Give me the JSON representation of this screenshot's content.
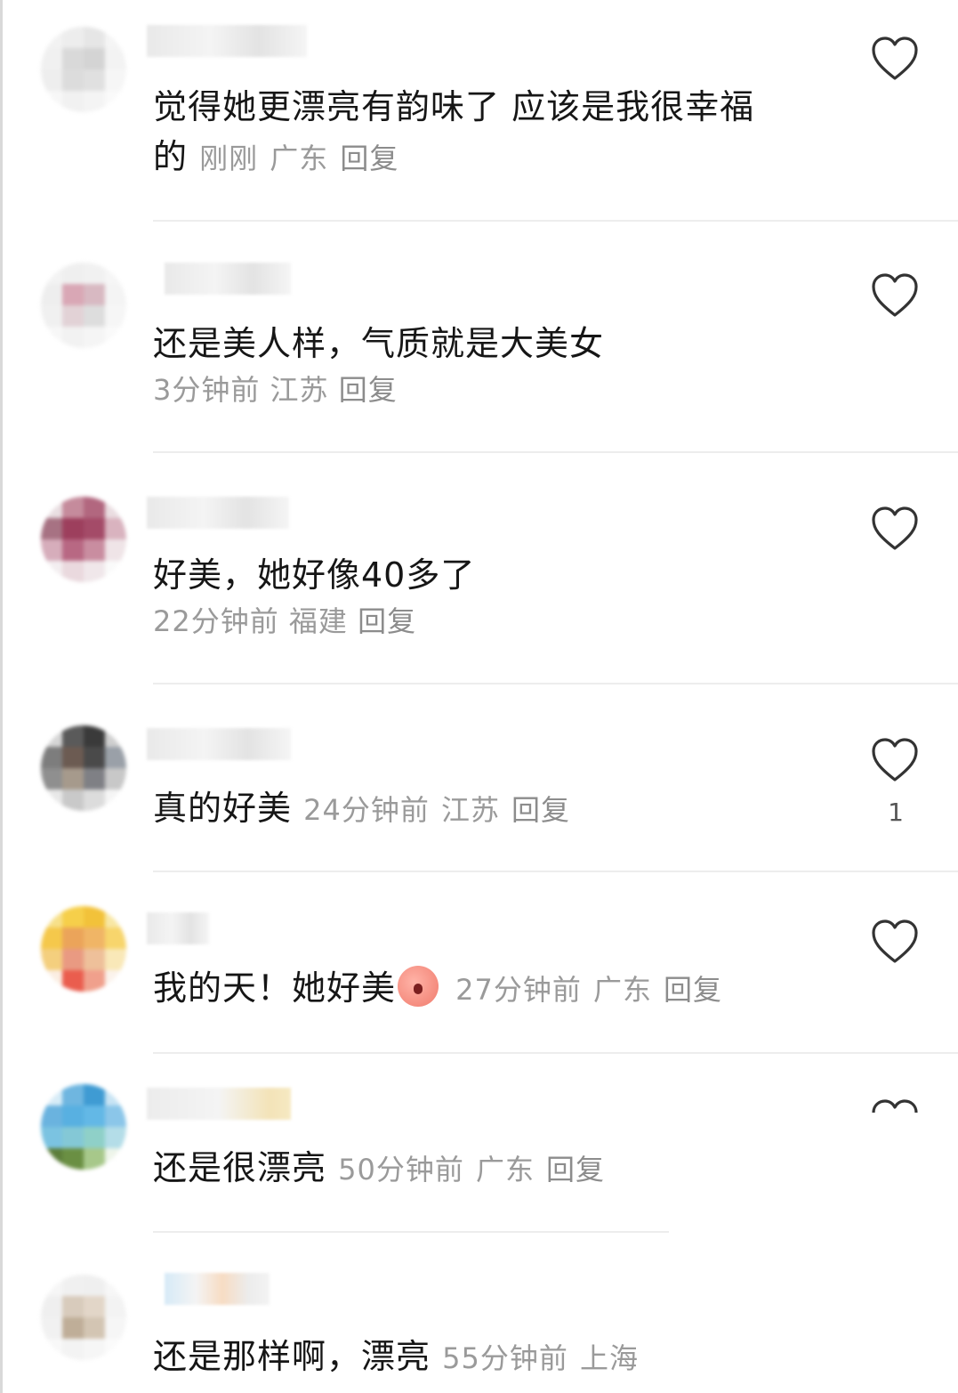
{
  "colors": {
    "text": "#161616",
    "meta": "#9a9a9a",
    "divider": "#ededed",
    "heart": "#333333"
  },
  "comments": [
    {
      "text": "觉得她更漂亮有韵味了 应该是我很幸福",
      "text2": "的",
      "time": "刚刚",
      "region": "广东",
      "reply": "回复",
      "likes": ""
    },
    {
      "text": "还是美人样，气质就是大美女",
      "time": "3分钟前",
      "region": "江苏",
      "reply": "回复",
      "likes": ""
    },
    {
      "text": "好美，她好像40多了",
      "time": "22分钟前",
      "region": "福建",
      "reply": "回复",
      "likes": ""
    },
    {
      "text": "真的好美",
      "time": "24分钟前",
      "region": "江苏",
      "reply": "回复",
      "likes": "1"
    },
    {
      "text": "我的天！她好美",
      "emoji": "emoji-face",
      "time": "27分钟前",
      "region": "广东",
      "reply": "回复",
      "likes": ""
    },
    {
      "text": "还是很漂亮",
      "time": "50分钟前",
      "region": "广东",
      "reply": "回复",
      "likes": ""
    },
    {
      "text": "还是那样啊，漂亮",
      "time": "55分钟前",
      "region": "上海",
      "reply": "",
      "likes": ""
    }
  ],
  "icons": {
    "like": "heart-outline-icon"
  }
}
